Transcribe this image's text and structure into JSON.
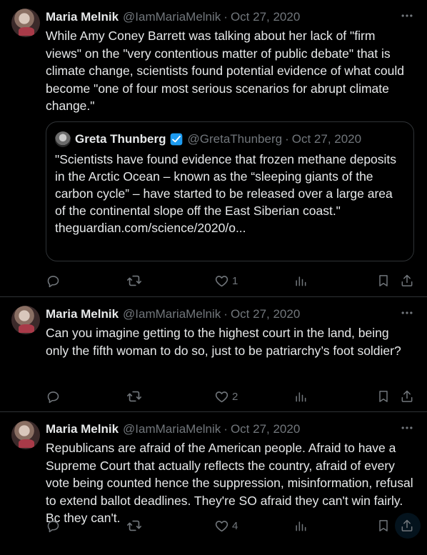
{
  "tweets": [
    {
      "name": "Maria Melnik",
      "handle": "@IamMariaMelnik",
      "dot": "·",
      "date": "Oct 27, 2020",
      "text": "While Amy Coney Barrett was talking about her lack of \"firm views\" on the \"very contentious matter of public debate\" that is climate change, scientists found potential evidence of what could become \"one of four most serious scenarios for abrupt climate change.\"",
      "quote": {
        "name": "Greta Thunberg",
        "handle": "@GretaThunberg",
        "dot": "·",
        "date": "Oct 27, 2020",
        "text": "\"Scientists have found evidence that frozen methane deposits in the Arctic Ocean – known as the “sleeping giants of the carbon cycle” – have started to be released over a large area of the continental slope off the East Siberian coast.\"",
        "link": "theguardian.com/science/2020/o..."
      },
      "likes": "1"
    },
    {
      "name": "Maria Melnik",
      "handle": "@IamMariaMelnik",
      "dot": "·",
      "date": "Oct 27, 2020",
      "text": "Can you imagine getting to the highest court in the land, being only the fifth woman to do so, just to be patriarchy’s foot soldier?",
      "likes": "2"
    },
    {
      "name": "Maria Melnik",
      "handle": "@IamMariaMelnik",
      "dot": "·",
      "date": "Oct 27, 2020",
      "text": "Republicans are afraid of the American people. Afraid to have a Supreme Court that actually reflects the country, afraid of every vote being counted hence the suppression, misinformation, refusal to extend ballot deadlines. They're SO afraid they can't win fairly. Bc they can't.",
      "likes": "4"
    }
  ],
  "icons": {
    "more": "more-icon",
    "reply": "reply-icon",
    "retweet": "retweet-icon",
    "like": "heart-icon",
    "views": "views-icon",
    "bookmark": "bookmark-icon",
    "share": "share-icon",
    "verified": "verified-badge-icon"
  },
  "colors": {
    "background": "#000000",
    "text": "#e7e9ea",
    "muted": "#71767b",
    "accent": "#1d9bf0",
    "border": "#2f3336"
  }
}
